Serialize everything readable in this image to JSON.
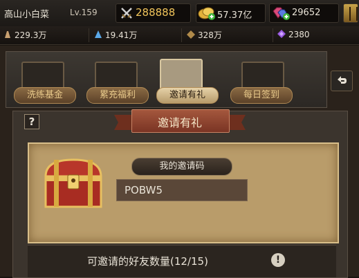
{
  "player": {
    "name": "高山小白菜",
    "level": "Lv.159"
  },
  "currencies": {
    "power": "288888",
    "gold": "57.37亿",
    "gems": "29652"
  },
  "resources": [
    {
      "icon": "wood-icon",
      "value": "229.3万"
    },
    {
      "icon": "crystal-icon",
      "value": "19.41万"
    },
    {
      "icon": "ore-icon",
      "value": "328万"
    },
    {
      "icon": "purple-gem-icon",
      "value": "2380"
    }
  ],
  "tabs": [
    {
      "label": "洗练基金",
      "active": false
    },
    {
      "label": "累充福利",
      "active": false
    },
    {
      "label": "邀请有礼",
      "active": true
    },
    {
      "label": "每日签到",
      "active": false
    }
  ],
  "panel": {
    "title": "邀请有礼",
    "help": "?",
    "code_label": "我的邀请码",
    "code_value": "POBW5",
    "friend_count_text": "可邀请的好友数量(12/15)",
    "info_glyph": "!"
  },
  "colors": {
    "power_text": "#f0c45a",
    "ribbon": "#a4573d",
    "parchment": "#b99c6a"
  }
}
